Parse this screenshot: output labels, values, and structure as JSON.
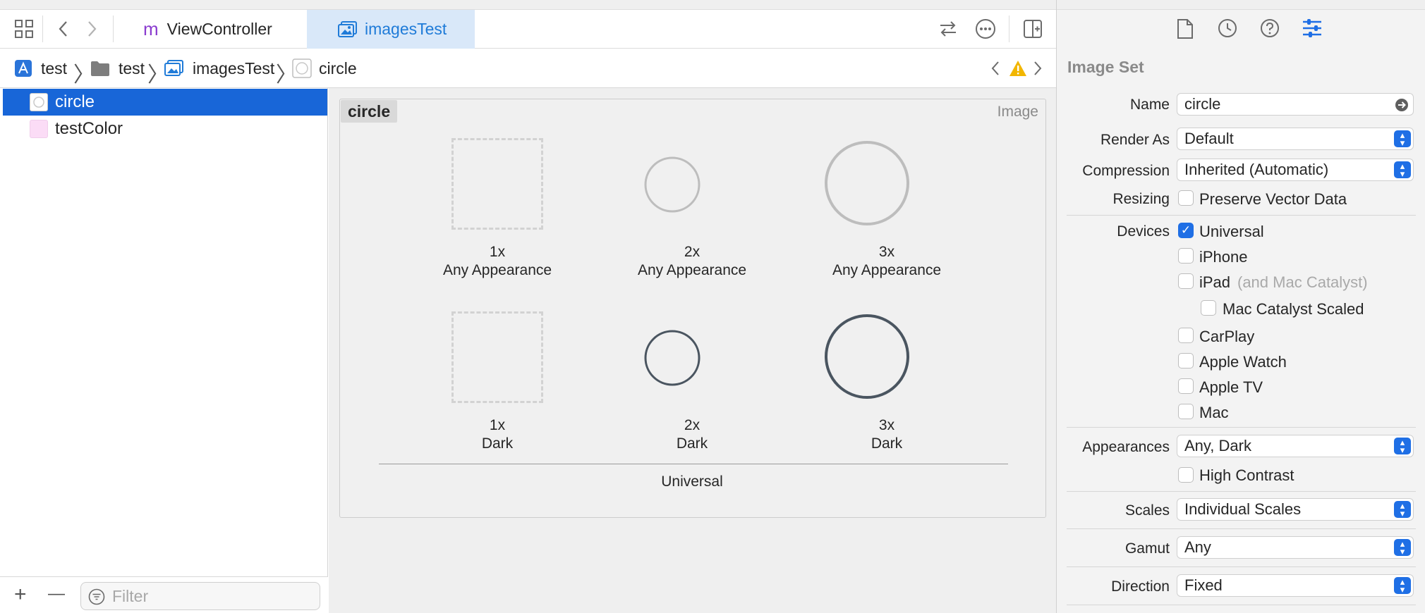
{
  "toolbar": {
    "tabs": [
      {
        "label": "ViewController",
        "prefix": "m"
      },
      {
        "label": "imagesTest"
      }
    ]
  },
  "breadcrumb": [
    "test",
    "test",
    "imagesTest",
    "circle"
  ],
  "navigator": {
    "items": [
      {
        "label": "circle",
        "selected": true
      },
      {
        "label": "testColor",
        "selected": false
      }
    ],
    "filter_placeholder": "Filter",
    "add_label": "+",
    "remove_label": "—"
  },
  "editor": {
    "set_name": "circle",
    "set_type": "Image",
    "slots": [
      {
        "scale": "1x",
        "appearance": "Any Appearance"
      },
      {
        "scale": "2x",
        "appearance": "Any Appearance"
      },
      {
        "scale": "3x",
        "appearance": "Any Appearance"
      },
      {
        "scale": "1x",
        "appearance": "Dark"
      },
      {
        "scale": "2x",
        "appearance": "Dark"
      },
      {
        "scale": "3x",
        "appearance": "Dark"
      }
    ],
    "group_label": "Universal"
  },
  "inspector": {
    "section_title": "Image Set",
    "name_label": "Name",
    "name_value": "circle",
    "render_as_label": "Render As",
    "render_as_value": "Default",
    "compression_label": "Compression",
    "compression_value": "Inherited (Automatic)",
    "resizing_label": "Resizing",
    "preserve_vector": "Preserve Vector Data",
    "devices_label": "Devices",
    "devices": [
      {
        "label": "Universal",
        "checked": true
      },
      {
        "label": "iPhone",
        "checked": false
      },
      {
        "label": "iPad",
        "suffix": "(and Mac Catalyst)",
        "checked": false
      },
      {
        "label": "Mac Catalyst Scaled",
        "checked": false
      },
      {
        "label": "CarPlay",
        "checked": false
      },
      {
        "label": "Apple Watch",
        "checked": false
      },
      {
        "label": "Apple TV",
        "checked": false
      },
      {
        "label": "Mac",
        "checked": false
      }
    ],
    "appearances_label": "Appearances",
    "appearances_value": "Any, Dark",
    "high_contrast": "High Contrast",
    "scales_label": "Scales",
    "scales_value": "Individual Scales",
    "gamut_label": "Gamut",
    "gamut_value": "Any",
    "direction_label": "Direction",
    "direction_value": "Fixed"
  },
  "colors": {
    "accent": "#1f6fe5",
    "selection": "#1866d8",
    "active_tab": "#d9e8f9",
    "warning": "#f2b600",
    "swift_m": "#8a3ccf",
    "testcolor_swatch": "#fbdcf6"
  }
}
